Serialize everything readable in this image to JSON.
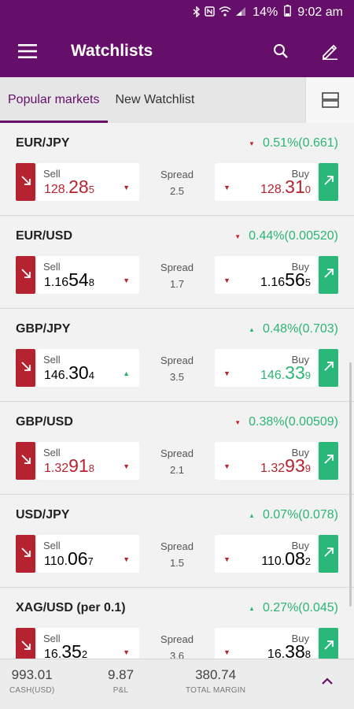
{
  "status": {
    "battery": "14%",
    "time": "9:02 am"
  },
  "appbar": {
    "title": "Watchlists",
    "menu_icon": "hamburger-icon",
    "search_icon": "search-icon",
    "edit_icon": "pencil-icon"
  },
  "tabs": [
    {
      "label": "Popular markets",
      "active": true
    },
    {
      "label": "New Watchlist",
      "active": false
    }
  ],
  "spread_label": "Spread",
  "sell_label": "Sell",
  "buy_label": "Buy",
  "markets": [
    {
      "name": "EUR/JPY",
      "change": "0.51%(0.661)",
      "direction": "down",
      "sell": {
        "pre": "128.",
        "big": "28",
        "small": "5",
        "color": "red",
        "trend": "down"
      },
      "spread": "2.5",
      "buy": {
        "pre": "128.",
        "big": "31",
        "small": "0",
        "color": "red",
        "trend": "down"
      }
    },
    {
      "name": "EUR/USD",
      "change": "0.44%(0.00520)",
      "direction": "down",
      "sell": {
        "pre": "1.16",
        "big": "54",
        "small": "8",
        "color": "black",
        "trend": "down"
      },
      "spread": "1.7",
      "buy": {
        "pre": "1.16",
        "big": "56",
        "small": "5",
        "color": "black",
        "trend": "down"
      }
    },
    {
      "name": "GBP/JPY",
      "change": "0.48%(0.703)",
      "direction": "up",
      "sell": {
        "pre": "146.",
        "big": "30",
        "small": "4",
        "color": "black",
        "trend": "up"
      },
      "spread": "3.5",
      "buy": {
        "pre": "146.",
        "big": "33",
        "small": "9",
        "color": "green",
        "trend": "down"
      }
    },
    {
      "name": "GBP/USD",
      "change": "0.38%(0.00509)",
      "direction": "down",
      "sell": {
        "pre": "1.32",
        "big": "91",
        "small": "8",
        "color": "red",
        "trend": "down"
      },
      "spread": "2.1",
      "buy": {
        "pre": "1.32",
        "big": "93",
        "small": "9",
        "color": "red",
        "trend": "down"
      }
    },
    {
      "name": "USD/JPY",
      "change": "0.07%(0.078)",
      "direction": "up",
      "sell": {
        "pre": "110.",
        "big": "06",
        "small": "7",
        "color": "black",
        "trend": "down"
      },
      "spread": "1.5",
      "buy": {
        "pre": "110.",
        "big": "08",
        "small": "2",
        "color": "black",
        "trend": "down"
      }
    },
    {
      "name": "XAG/USD (per 0.1)",
      "change": "0.27%(0.045)",
      "direction": "up",
      "sell": {
        "pre": "16.",
        "big": "35",
        "small": "2",
        "color": "black",
        "trend": "down"
      },
      "spread": "3.6",
      "buy": {
        "pre": "16.",
        "big": "38",
        "small": "8",
        "color": "black",
        "trend": "down"
      }
    }
  ],
  "footer": {
    "cash": {
      "value": "993.01",
      "label": "CASH(USD)"
    },
    "pnl": {
      "value": "9.87",
      "label": "P&L"
    },
    "margin": {
      "value": "380.74",
      "label": "TOTAL MARGIN"
    }
  },
  "colors": {
    "brand": "#650f6a",
    "sell": "#b52330",
    "buy": "#29b87a",
    "up": "#2bb673"
  }
}
